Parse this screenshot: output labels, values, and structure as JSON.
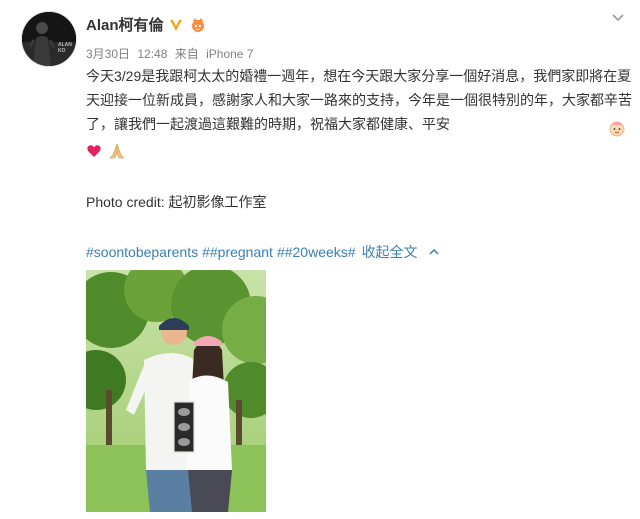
{
  "user": {
    "name": "Alan柯有倫",
    "avatar_text": "ALAN KO"
  },
  "meta": {
    "date": "3月30日",
    "time": "12:48",
    "source_prefix": "来自",
    "source": "iPhone 7"
  },
  "post": {
    "text": "今天3/29是我跟柯太太的婚禮一週年，想在今天跟大家分享一個好消息，我們家即將在夏天迎接一位新成員，感謝家人和大家一路來的支持，今年是一個很特別的年，大家都辛苦了，讓我們一起渡過這艱難的時期，祝福大家都健康、平安",
    "credit": "Photo credit: 起初影像工作室"
  },
  "tags": [
    "#soontobeparents",
    "##pregnant",
    "##20weeks#"
  ],
  "collapse_label": "收起全文",
  "colors": {
    "link": "#3a7fb6",
    "verified": "#f5a623",
    "text": "#333333",
    "meta": "#808080"
  },
  "icons": {
    "verified": "verified-v-icon",
    "vip": "vip-badge-icon",
    "more": "chevron-down-icon",
    "collapse": "chevron-up-icon",
    "emoji_baby": "baby-emoji",
    "emoji_heart": "heart-emoji",
    "emoji_pray": "pray-emoji"
  }
}
